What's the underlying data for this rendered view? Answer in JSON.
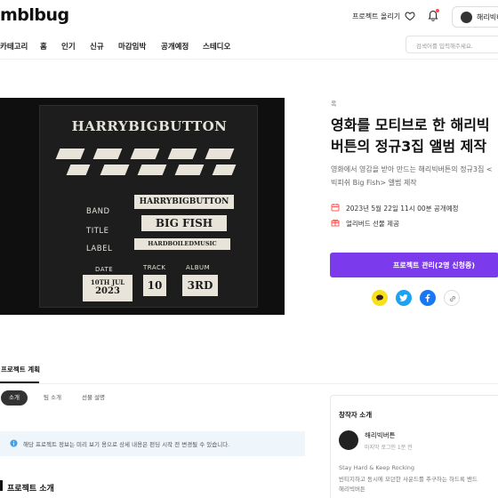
{
  "header": {
    "logo": "mblbug",
    "upload_link": "프로젝트 올리기",
    "username": "해리빅버튼",
    "icons": {
      "like": "heart-icon",
      "notification": "bell-icon"
    },
    "notification_color": "#ff4b4b"
  },
  "nav": {
    "items": [
      "카테고리",
      "홈",
      "인기",
      "신규",
      "마감임박",
      "공개예정",
      "스테디오"
    ],
    "search_placeholder": "검색어를 입력해주세요."
  },
  "album": {
    "title": "HARRYBIGBUTTON",
    "band_label": "BAND",
    "band_value": "HARRYBIGBUTTON",
    "title_label": "TITLE",
    "title_value": "BIG FISH",
    "label_label": "LABEL",
    "label_value": "HARDBOILEDMUSIC",
    "date_label": "DATE",
    "date_value_line1": "10TH JUL",
    "date_value_line2": "2023",
    "track_label": "TRACK",
    "track_value": "10",
    "album_label": "ALBUM",
    "album_value": "3RD"
  },
  "project": {
    "category": "록",
    "title_line1": "영화를 모티브로 한 해리빅",
    "title_line2": "버튼의 정규3집 앨범 제작",
    "desc_line1": "영화에서 영감을 받아 만드는 해리빅버튼의 정규3집 <",
    "desc_line2": "빅피쉬 Big Fish> 앨범 제작",
    "schedule": "2023년 5월 22일 11시 00분 공개예정",
    "gift": "얼리버드 선물 제공",
    "manage_button": "프로젝트 관리(2명 신청중)",
    "accent_color": "#7c3aed",
    "share_icons": [
      "kakao-icon",
      "twitter-icon",
      "facebook-icon",
      "link-icon"
    ]
  },
  "tabs": {
    "main": "프로젝트 계획",
    "subtabs": [
      "소개",
      "팀 소개",
      "선물 설명"
    ],
    "active_index": 0
  },
  "notice": "해당 프로젝트 정보는 미리 보기 용으로 상세 내용은 펀딩 시작 전 변경될 수 있습니다.",
  "section_title": "프로젝트 소개",
  "creator": {
    "heading": "창작자 소개",
    "name": "해리빅버튼",
    "last_login": "마지막 로그인 1분 전",
    "bio_line1": "Stay Hard & Keep Rocking",
    "bio_line2": "빈티지하고 동시에 모던한 사운드를 추구하는 하드록 밴드",
    "bio_line3": "해리빅버튼"
  }
}
